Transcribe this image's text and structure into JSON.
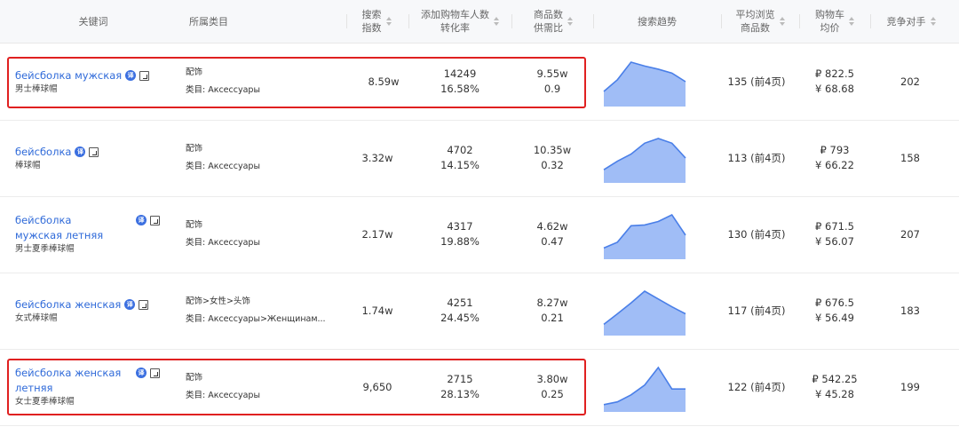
{
  "headers": {
    "keyword": "关键词",
    "category": "所属类目",
    "search_index": [
      "搜索",
      "指数"
    ],
    "cart": [
      "添加购物车人数",
      "转化率"
    ],
    "supply": [
      "商品数",
      "供需比"
    ],
    "trend": "搜索趋势",
    "avg_browse": [
      "平均浏览",
      "商品数"
    ],
    "cart_price": [
      "购物车",
      "均价"
    ],
    "competitors": "竞争对手"
  },
  "translate_badge": "译",
  "rows": [
    {
      "keyword": "бейсболка мужская",
      "keyword_zh": "男士棒球帽",
      "category_top": "配饰",
      "category_sub": "类目:  Аксессуары",
      "search_index": "8.59w",
      "cart_count": "14249",
      "conversion": "16.58%",
      "goods_count": "9.55w",
      "supply_ratio": "0.9",
      "avg_browse": "135 (前4页)",
      "price_rub": "₽ 822.5",
      "price_cny": "¥ 68.68",
      "competitors": "202",
      "highlighted": true,
      "trend": [
        0.25,
        0.55,
        1.0,
        0.9,
        0.82,
        0.72,
        0.5
      ]
    },
    {
      "keyword": "бейсболка",
      "keyword_zh": "棒球帽",
      "category_top": "配饰",
      "category_sub": "类目:  Аксессуары",
      "search_index": "3.32w",
      "cart_count": "4702",
      "conversion": "14.15%",
      "goods_count": "10.35w",
      "supply_ratio": "0.32",
      "avg_browse": "113 (前4页)",
      "price_rub": "₽ 793",
      "price_cny": "¥ 66.22",
      "competitors": "158",
      "highlighted": false,
      "trend": [
        0.2,
        0.42,
        0.6,
        0.88,
        1.0,
        0.88,
        0.5
      ]
    },
    {
      "keyword": "бейсболка мужская летняя",
      "keyword_zh": "男士夏季棒球帽",
      "category_top": "配饰",
      "category_sub": "类目:  Аксессуары",
      "search_index": "2.17w",
      "cart_count": "4317",
      "conversion": "19.88%",
      "goods_count": "4.62w",
      "supply_ratio": "0.47",
      "avg_browse": "130 (前4页)",
      "price_rub": "₽ 671.5",
      "price_cny": "¥ 56.07",
      "competitors": "207",
      "highlighted": false,
      "trend": [
        0.15,
        0.3,
        0.72,
        0.74,
        0.83,
        1.0,
        0.48
      ]
    },
    {
      "keyword": "бейсболка женская",
      "keyword_zh": "女式棒球帽",
      "category_top": "配饰>女性>头饰",
      "category_sub": "类目:  Аксессуары>Женщинам...",
      "search_index": "1.74w",
      "cart_count": "4251",
      "conversion": "24.45%",
      "goods_count": "8.27w",
      "supply_ratio": "0.21",
      "avg_browse": "117 (前4页)",
      "price_rub": "₽ 676.5",
      "price_cny": "¥ 56.49",
      "competitors": "183",
      "highlighted": false,
      "trend": [
        0.15,
        0.42,
        0.7,
        1.0,
        0.8,
        0.6,
        0.42
      ]
    },
    {
      "keyword": "бейсболка женская летняя",
      "keyword_zh": "女士夏季棒球帽",
      "category_top": "配饰",
      "category_sub": "类目:  Аксессуары",
      "search_index": "9,650",
      "cart_count": "2715",
      "conversion": "28.13%",
      "goods_count": "3.80w",
      "supply_ratio": "0.25",
      "avg_browse": "122 (前4页)",
      "price_rub": "₽ 542.25",
      "price_cny": "¥ 45.28",
      "competitors": "199",
      "highlighted": true,
      "trend": [
        0.05,
        0.12,
        0.3,
        0.55,
        1.0,
        0.45,
        0.45
      ]
    }
  ],
  "colors": {
    "link": "#2f6ad9",
    "trend_line": "#4a7fe8",
    "trend_fill": "#8fb1f5",
    "highlight_border": "#e02020",
    "header_bg": "#f7f8fa"
  }
}
